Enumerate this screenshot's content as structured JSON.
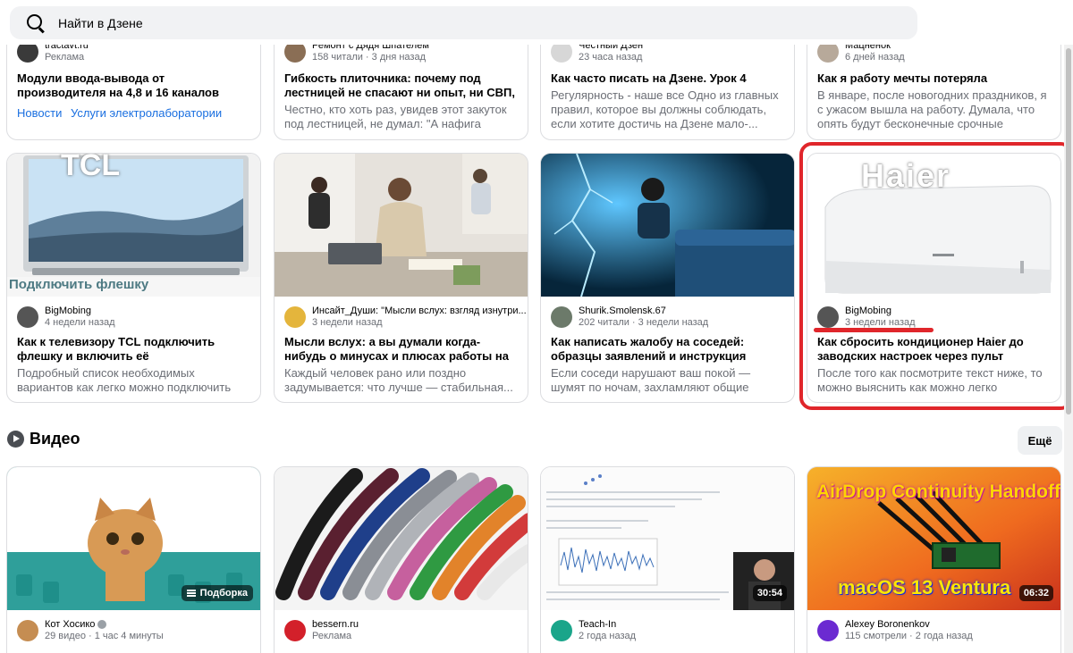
{
  "search": {
    "placeholder": "Найти в Дзене"
  },
  "top_row": [
    {
      "channel": "tractavt.ru",
      "sub": "Реклама",
      "title": "Модули ввода-вывода от производителя на 4,8 и 16 каналов",
      "links": [
        "Новости",
        "Услуги электролаборатории"
      ]
    },
    {
      "channel": "Ремонт с Дядя Шпателем",
      "sub": "158 читали · 3 дня назад",
      "title": "Гибкость плиточника: почему под лестницей не спасают ни опыт, ни СВП, н...",
      "desc": "Честно, кто хоть раз, увидев этот закуток под лестницей, не думал: \"А нафига вообще..."
    },
    {
      "channel": "Честный Дзен",
      "sub": "23 часа назад",
      "title": "Как часто писать на Дзене. Урок 4",
      "desc": "Регулярность - наше все Одно из главных правил, которое вы должны соблюдать, если хотите достичь на Дзене мало-..."
    },
    {
      "channel": "Мацненок",
      "sub": "6 дней назад",
      "title": "Как я работу мечты потеряла",
      "desc": "В январе, после новогодних праздников, я с ужасом вышла на работу. Думала, что опять будут бесконечные срочные задания,..."
    }
  ],
  "mid_row": [
    {
      "thumb_text": "TCL",
      "thumb_caption": "Подключить флешку",
      "channel": "BigMobing",
      "sub": "4 недели назад",
      "title": "Как к телевизору TCL подключить флешку и включить её",
      "desc": "Подробный список необходимых вариантов как легко можно подключить флешку к..."
    },
    {
      "channel": "Инсайт_Души: \"Мысли вслух: взгляд изнутри...",
      "sub": "3 недели назад",
      "title": "Мысли вслух: а вы думали когда-нибудь о минусах и плюсах работы на \"дядю\" и на...",
      "desc": "Каждый человек рано или поздно задумывается: что лучше — стабильная..."
    },
    {
      "channel": "Shurik.Smolensk.67",
      "sub": "202 читали · 3 недели назад",
      "title": "Как написать жалобу на соседей: образцы заявлений и инструкция",
      "desc": "Если соседи нарушают ваш покой — шумят по ночам, захламляют общие территории,..."
    },
    {
      "thumb_text": "Haier",
      "channel": "BigMobing",
      "sub": "3 недели назад",
      "title": "Как сбросить кондиционер Haier до заводских настроек через пульт",
      "desc": "После того как посмотрите текст ниже, то можно выяснить как можно легко сбросить..."
    }
  ],
  "video_section": {
    "title": "Видео",
    "more_label": "Ещё"
  },
  "videos": [
    {
      "badge": "Подборка",
      "channel": "Кот Хосико",
      "sub": "29 видео · 1 час 4 минуты"
    },
    {
      "channel": "bessern.ru",
      "sub": "Реклама"
    },
    {
      "duration": "30:54",
      "channel": "Teach-In",
      "sub": "2 года назад"
    },
    {
      "overlay_top": "AirDrop Continuity Handoff",
      "overlay_bottom": "macOS 13 Ventura",
      "duration": "06:32",
      "channel": "Alexey Boronenkov",
      "sub": "115 смотрели · 2 года назад"
    }
  ],
  "colors": {
    "accent_red": "#e0262b",
    "link_blue": "#1a6fe0",
    "muted": "#6b6e75"
  }
}
